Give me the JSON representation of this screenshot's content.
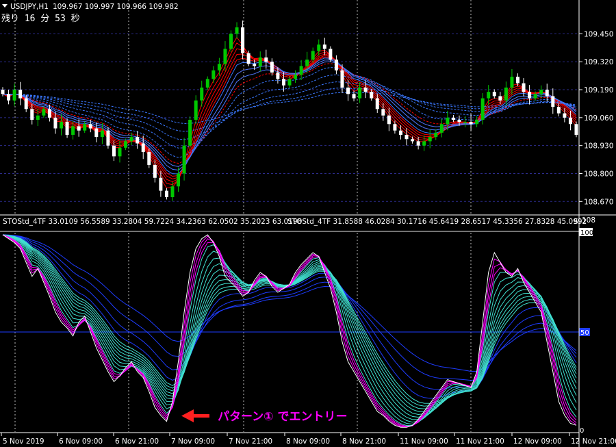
{
  "chart_data": [
    {
      "type": "candlestick",
      "symbol_label": "USDJPY,H1",
      "ohlc_readout": "109.967 109.997 109.966 109.982",
      "countdown": "残り 16 分 53 秒",
      "ylim": [
        108.62,
        109.55
      ],
      "y_ticks": [
        "109.450",
        "109.320",
        "109.190",
        "109.060",
        "108.930",
        "108.800",
        "108.670"
      ],
      "grid": true,
      "colors": {
        "bull": "#00c800",
        "bear": "#ffffff",
        "ma_fast": "#ff0000",
        "ma_slow": "#3b78ff",
        "grid": "#2b2b8a"
      },
      "close": [
        109.17,
        109.14,
        109.19,
        109.15,
        109.1,
        109.05,
        109.07,
        109.1,
        109.06,
        109.01,
        109.04,
        108.98,
        109.02,
        109.0,
        109.03,
        109.01,
        108.97,
        109.0,
        108.93,
        108.88,
        108.92,
        108.95,
        108.97,
        108.94,
        108.9,
        108.84,
        108.78,
        108.72,
        108.69,
        108.74,
        108.8,
        108.93,
        109.05,
        109.14,
        109.2,
        109.24,
        109.28,
        109.31,
        109.38,
        109.45,
        109.48,
        109.36,
        109.31,
        109.3,
        109.34,
        109.32,
        109.27,
        109.24,
        109.21,
        109.24,
        109.26,
        109.3,
        109.33,
        109.37,
        109.4,
        109.38,
        109.33,
        109.28,
        109.2,
        109.17,
        109.15,
        109.2,
        109.18,
        109.15,
        109.1,
        109.07,
        109.03,
        109.0,
        108.98,
        108.96,
        108.95,
        108.93,
        108.95,
        108.97,
        108.99,
        109.03,
        109.06,
        109.05,
        109.04,
        109.04,
        109.03,
        109.05,
        109.15,
        109.18,
        109.16,
        109.14,
        109.2,
        109.25,
        109.22,
        109.18,
        109.15,
        109.17,
        109.19,
        109.16,
        109.11,
        109.08,
        109.06,
        109.03,
        108.98
      ]
    },
    {
      "type": "line",
      "indicator_label": "STOStd_4TF 33.0109 56.5589 33.2804 59.7224 34.2363 62.0502 35.2023 63.0198",
      "indicator_label_2": "STOStd_4TF 31.8588 46.0284 30.1716 45.6419 28.6517 45.3356 27.8328 45.0992",
      "indicator_label_tail": "S",
      "ylim": [
        0,
        100
      ],
      "top_label": "100",
      "mid_level": 50,
      "mid_label": "50",
      "bottom_label": "0",
      "top_right_label": "108",
      "colors": {
        "raw": "#ffffff",
        "fast": "#ff00ff",
        "mid": "#40e0d0",
        "slow": "#1e3cff",
        "level": "#1e3cff"
      },
      "raw": [
        99,
        97,
        95,
        92,
        85,
        78,
        82,
        75,
        68,
        60,
        55,
        52,
        48,
        55,
        58,
        50,
        42,
        36,
        30,
        25,
        28,
        32,
        35,
        30,
        27,
        20,
        12,
        8,
        5,
        15,
        35,
        60,
        80,
        92,
        97,
        99,
        95,
        88,
        78,
        75,
        72,
        68,
        70,
        76,
        80,
        78,
        73,
        70,
        72,
        74,
        80,
        84,
        87,
        90,
        88,
        80,
        72,
        60,
        45,
        35,
        30,
        25,
        20,
        15,
        10,
        8,
        5,
        3,
        2,
        2,
        3,
        6,
        10,
        14,
        18,
        22,
        26,
        25,
        24,
        23,
        22,
        30,
        55,
        80,
        90,
        85,
        80,
        78,
        82,
        75,
        70,
        65,
        60,
        45,
        30,
        15,
        8,
        4,
        3
      ],
      "annotation": "パターン① でエントリー"
    }
  ],
  "x_axis": {
    "labels": [
      "5 Nov 2019",
      "6 Nov 09:00",
      "6 Nov 21:00",
      "7 Nov 09:00",
      "7 Nov 21:00",
      "8 Nov 09:00",
      "8 Nov 21:00",
      "11 Nov 09:00",
      "11 Nov 21:00",
      "12 Nov 09:00",
      "12 Nov 21:00"
    ]
  }
}
